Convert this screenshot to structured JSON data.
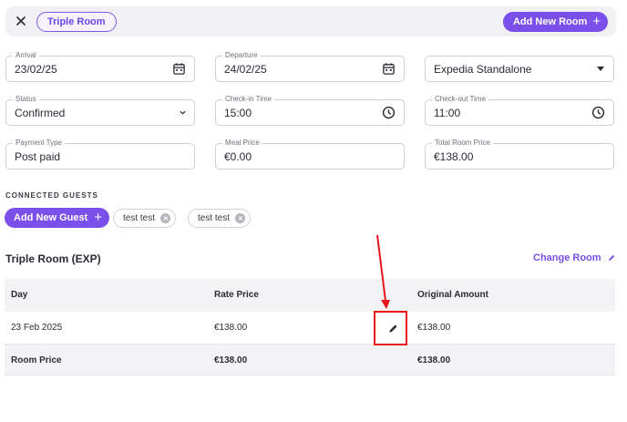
{
  "header": {
    "room_chip": "Triple Room",
    "add_room_label": "Add New Room"
  },
  "fields": {
    "arrival": {
      "label": "Arrival",
      "value": "23/02/25"
    },
    "departure": {
      "label": "Departure",
      "value": "24/02/25"
    },
    "channel": {
      "value": "Expedia Standalone"
    },
    "status": {
      "label": "Status",
      "value": "Confirmed"
    },
    "checkin": {
      "label": "Check-in Time",
      "value": "15:00"
    },
    "checkout": {
      "label": "Check-out Time",
      "value": "11:00"
    },
    "payment": {
      "label": "Payment Type",
      "value": "Post paid"
    },
    "meal": {
      "label": "Meal Price",
      "value": "€0.00"
    },
    "total": {
      "label": "Total Room Price",
      "value": "€138.00"
    }
  },
  "guests": {
    "section_title": "CONNECTED GUESTS",
    "add_label": "Add New Guest",
    "chips": [
      "test test",
      "test test"
    ]
  },
  "rates": {
    "title": "Triple Room (EXP)",
    "change_room": "Change Room",
    "columns": [
      "Day",
      "Rate Price",
      "Original Amount"
    ],
    "rows": [
      {
        "day": "23 Feb 2025",
        "rate": "€138.00",
        "original": "€138.00"
      }
    ],
    "footer": {
      "label": "Room Price",
      "rate": "€138.00",
      "original": "€138.00"
    }
  },
  "colors": {
    "accent": "#7b4fe9",
    "highlight": "#e8121b"
  }
}
